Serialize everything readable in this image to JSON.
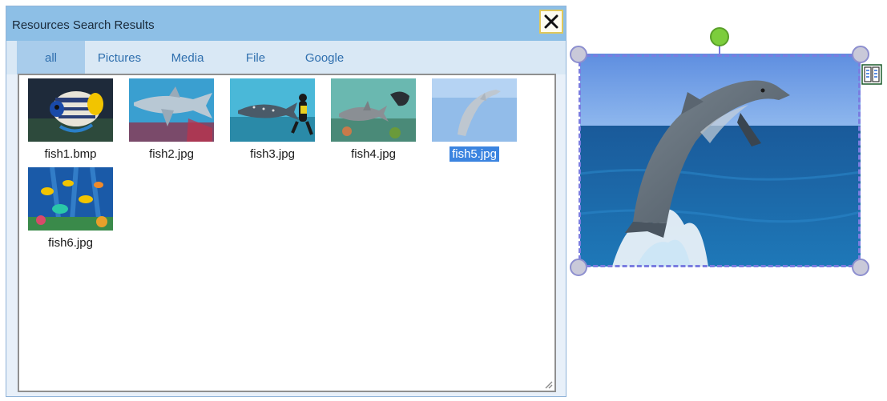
{
  "panel": {
    "title": "Resources Search Results",
    "tabs": [
      {
        "label": "all",
        "active": true
      },
      {
        "label": "Pictures",
        "active": false
      },
      {
        "label": "Media",
        "active": false
      },
      {
        "label": "File",
        "active": false
      },
      {
        "label": "Google",
        "active": false
      }
    ],
    "files": [
      {
        "name": "fish1.bmp",
        "selected": false
      },
      {
        "name": "fish2.jpg",
        "selected": false
      },
      {
        "name": "fish3.jpg",
        "selected": false
      },
      {
        "name": "fish4.jpg",
        "selected": false
      },
      {
        "name": "fish5.jpg",
        "selected": true
      },
      {
        "name": "fish6.jpg",
        "selected": false
      }
    ]
  },
  "canvas": {
    "image_subject": "dolphin"
  },
  "colors": {
    "selection": "#3b84e0",
    "tab_text": "#2f6fae",
    "handle_rotate": "#7ccd3c"
  }
}
